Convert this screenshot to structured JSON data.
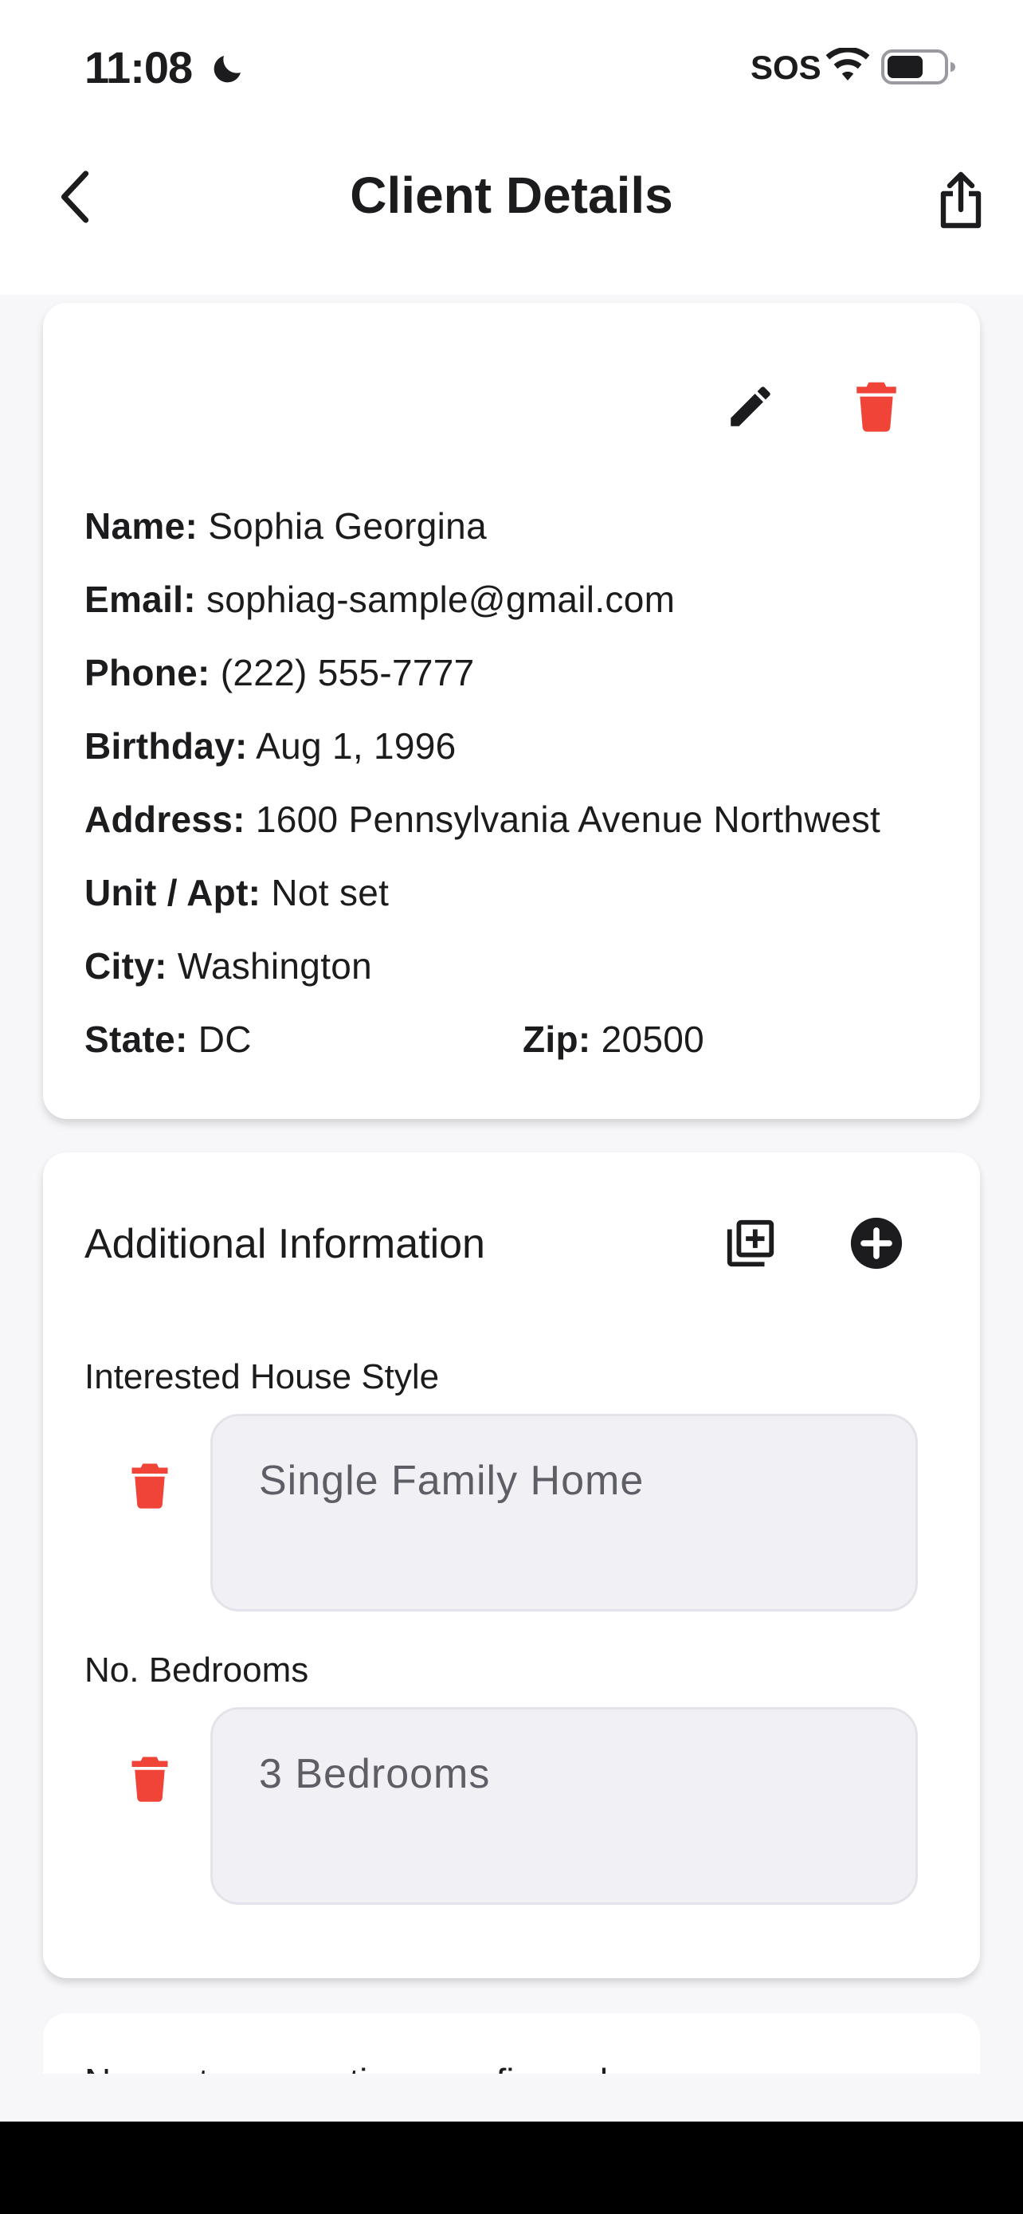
{
  "status_bar": {
    "time": "11:08",
    "sos": "SOS",
    "icons": [
      "moon-icon",
      "wifi-icon",
      "battery-icon"
    ]
  },
  "nav": {
    "title": "Client Details",
    "back_icon": "chevron-left-icon",
    "share_icon": "share-icon"
  },
  "client": {
    "edit_icon": "pencil-icon",
    "delete_icon": "trash-icon",
    "fields": [
      {
        "label": "Name:",
        "value": "Sophia Georgina"
      },
      {
        "label": "Email:",
        "value": "sophiag-sample@gmail.com"
      },
      {
        "label": "Phone:",
        "value": "(222) 555-7777"
      },
      {
        "label": "Birthday:",
        "value": "Aug 1, 1996"
      },
      {
        "label": "Address:",
        "value": "1600 Pennsylvania Avenue Northwest"
      },
      {
        "label": "Unit / Apt:",
        "value": "Not set"
      },
      {
        "label": "City:",
        "value": "Washington"
      },
      {
        "label": "State:",
        "value": "DC"
      },
      {
        "label": "Zip:",
        "value": "20500"
      }
    ]
  },
  "additional": {
    "title": "Additional Information",
    "add_multiple_icon": "add-box-multiple-icon",
    "add_icon": "plus-circle-icon",
    "items": [
      {
        "label": "Interested House Style",
        "value": "Single Family Home"
      },
      {
        "label": "No. Bedrooms",
        "value": "3 Bedrooms"
      }
    ]
  },
  "custom_questions": {
    "note": "No custom questions configured"
  },
  "colors": {
    "danger": "#f04438",
    "text": "#1c1c1e",
    "field_bg": "#f1f1f5"
  }
}
